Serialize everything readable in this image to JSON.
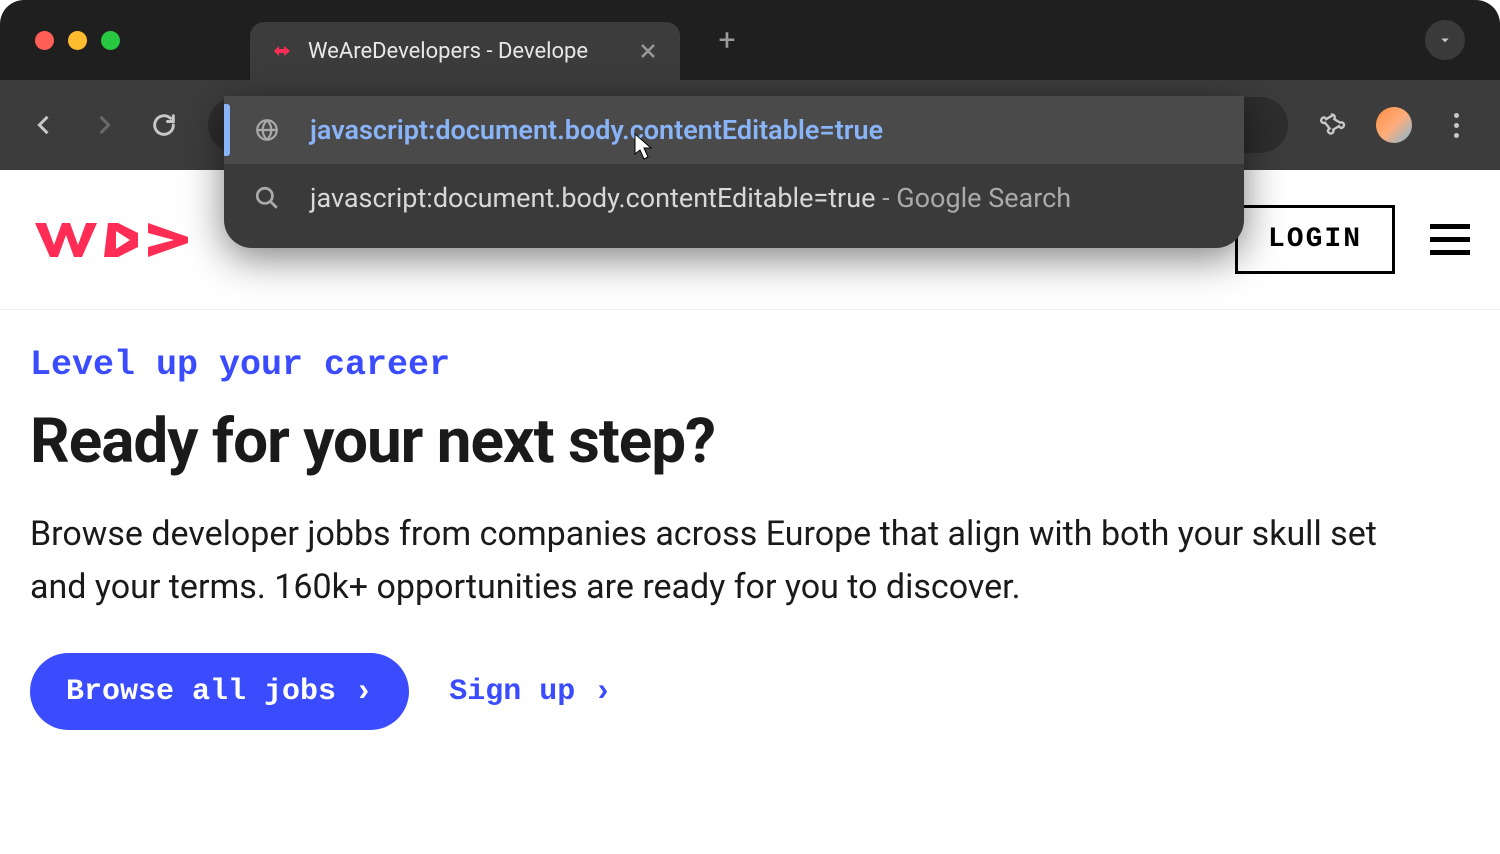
{
  "browser": {
    "tab": {
      "title": "WeAreDevelopers - Develope"
    },
    "address": "javascript:document.body.contentEditable=true",
    "suggestions": [
      {
        "text": "javascript:document.body.contentEditable=true",
        "type": "url",
        "selected": true
      },
      {
        "text": "javascript:document.body.contentEditable=true",
        "suffix": " - Google Search",
        "type": "search",
        "selected": false
      }
    ]
  },
  "header": {
    "login_label": "LOGIN"
  },
  "hero": {
    "eyebrow": "Level up your career",
    "headline": "Ready for your next step?",
    "body": "Browse developer jobbs from companies across Europe that align with both your skull set and your terms. 160k+ opportunities are ready for you to discover.",
    "cta_primary": "Browse all jobs",
    "cta_secondary": "Sign up"
  }
}
